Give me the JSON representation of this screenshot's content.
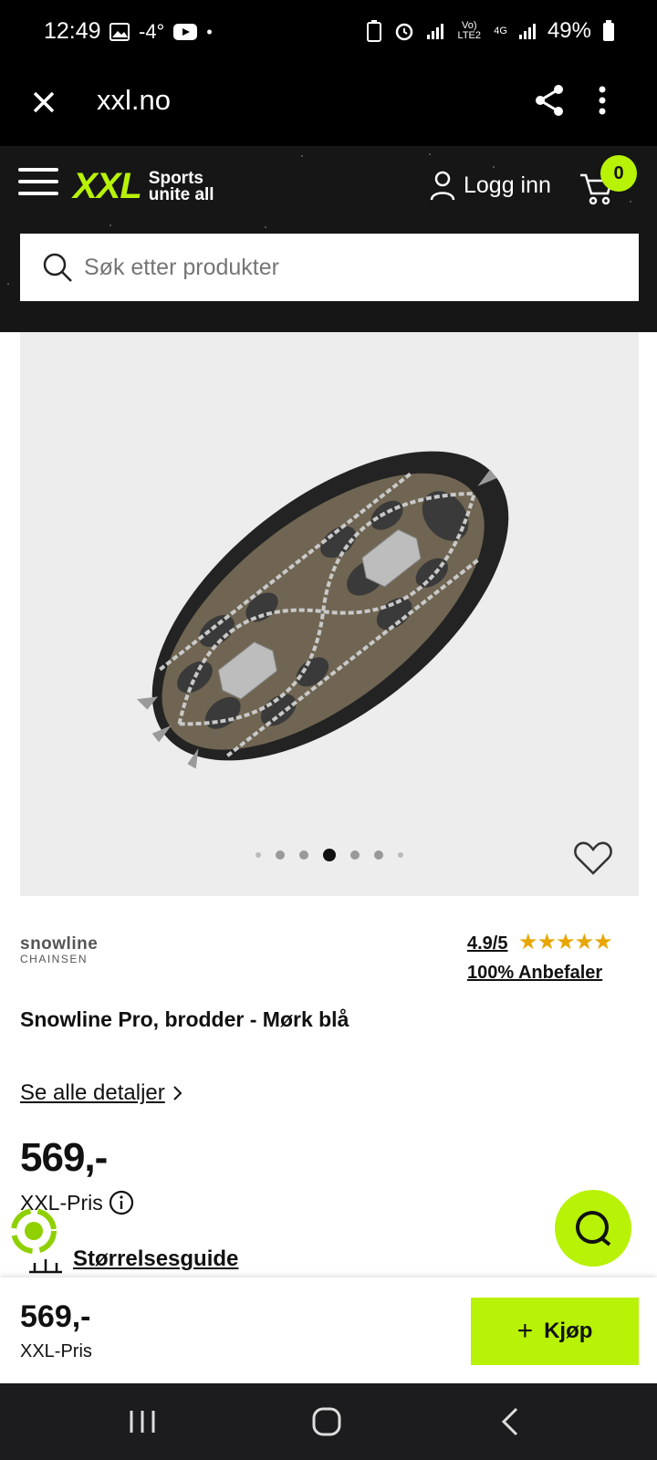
{
  "status_bar": {
    "time": "12:49",
    "temp": "-4°",
    "network": "Vo) LTE2",
    "net_type": "4G",
    "battery": "49%"
  },
  "browser": {
    "url": "xxl.no"
  },
  "header": {
    "logo_text": "XXL",
    "tagline_1": "Sports",
    "tagline_2": "unite all",
    "login_label": "Logg inn",
    "cart_count": "0",
    "search_placeholder": "Søk etter produkter",
    "accent_color": "#b8f207"
  },
  "product": {
    "brand_name": "snowline",
    "brand_sub": "CHAINSEN",
    "rating": "4.9/5",
    "stars": "★★★★★",
    "recommend": "100% Anbefaler",
    "title": "Snowline Pro, brodder - Mørk blå",
    "details_link": "Se alle detaljer",
    "price": "569,-",
    "price_label": "XXL-Pris",
    "size_guide": "Størrelsesguide",
    "carousel": {
      "total": 7,
      "active_index": 3
    }
  },
  "buy_bar": {
    "price": "569,-",
    "price_label": "XXL-Pris",
    "buy_label": "Kjøp"
  }
}
